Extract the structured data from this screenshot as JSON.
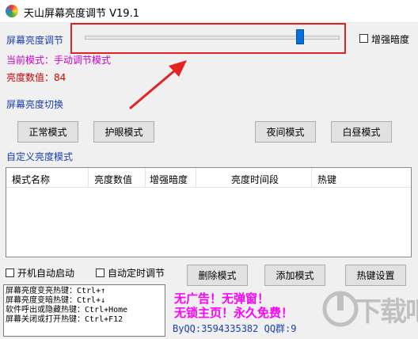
{
  "window": {
    "title": "天山屏幕亮度调节 V19.1"
  },
  "brightness_section": {
    "label": "屏幕亮度调节",
    "slider_level_fraction": 0.85,
    "enhance_dark_label": "增强暗度",
    "enhance_dark_checked": false
  },
  "status": {
    "mode_text": "当前模式：手动调节模式",
    "value_text": "亮度数值：84"
  },
  "switch_section": {
    "label": "屏幕亮度切换",
    "buttons": [
      "正常模式",
      "护眼模式",
      "夜间模式",
      "白昼模式"
    ]
  },
  "custom_section": {
    "label": "自定义亮度模式",
    "columns": [
      "模式名称",
      "亮度数值",
      "增强暗度",
      "亮度时间段",
      "热键"
    ],
    "rows": []
  },
  "options": {
    "autostart_label": "开机自动启动",
    "autostart_checked": false,
    "timed_label": "自动定时调节",
    "timed_checked": false
  },
  "actions": {
    "delete_label": "删除模式",
    "add_label": "添加模式",
    "hotkey_label": "热键设置"
  },
  "hotkeys": [
    "屏幕亮度变亮热键：Ctrl+↑",
    "屏幕亮度变暗热键：Ctrl+↓",
    "软件呼出或隐藏热键：Ctrl+Home",
    "屏幕关闭或打开热键：Ctrl+F12"
  ],
  "ad": {
    "line1": "无广告！无弹窗！",
    "line2": "无锁主页！永久免费！",
    "line3": "ByQQ:3594335382 QQ群:9"
  },
  "watermark": {
    "text": "下载吧"
  },
  "colors": {
    "label_blue": "#1a3fb0",
    "mode_magenta": "#cc00cc",
    "value_red": "#d00000",
    "highlight_red": "#e52222",
    "ad_pink": "#ff00ff",
    "thumb_blue": "#0a6fd6"
  }
}
